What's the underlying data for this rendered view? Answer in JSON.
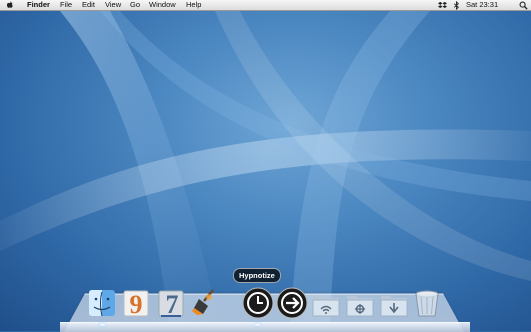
{
  "menubar": {
    "apple_icon": "apple-logo-icon",
    "app_name": "Finder",
    "menus": [
      "File",
      "Edit",
      "View",
      "Go",
      "Window",
      "Help"
    ],
    "status_icons": [
      "dropbox-icon",
      "bluetooth-icon",
      "volume-icon"
    ],
    "clock": "Sat 23:31",
    "spotlight_icon": "spotlight-search-icon"
  },
  "dock": {
    "tooltip": "Hypnotize",
    "items": [
      {
        "icon": "finder-icon"
      },
      {
        "icon": "garageband-9-icon"
      },
      {
        "icon": "app-7-icon"
      },
      {
        "icon": "broom-app-icon"
      },
      {
        "icon": "clock-app-icon"
      },
      {
        "icon": "arrow-app-icon"
      },
      {
        "icon": "network-folder-icon"
      },
      {
        "icon": "utilities-folder-icon"
      },
      {
        "icon": "downloads-folder-icon"
      },
      {
        "icon": "trash-icon"
      }
    ]
  }
}
